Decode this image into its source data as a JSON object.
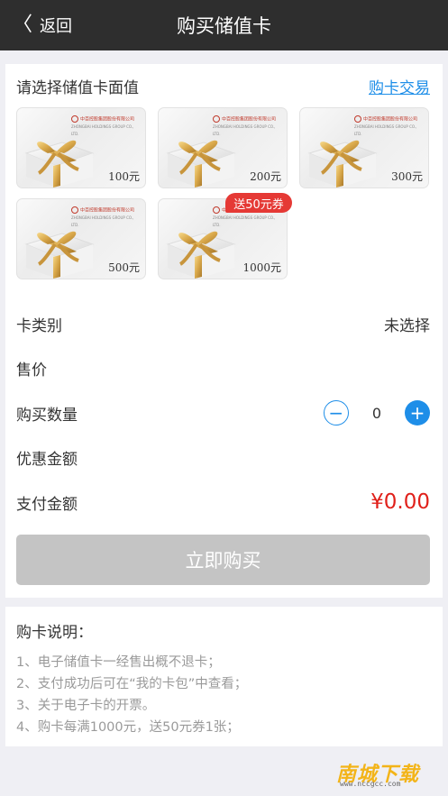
{
  "nav": {
    "back_icon": "〈",
    "back_label": "返回",
    "title": "购买储值卡"
  },
  "section": {
    "title": "请选择储值卡面值",
    "link": "购卡交易"
  },
  "card_logo": {
    "company": "中百控股集团股份有限公司",
    "company_en": "ZHONGBAI HOLDINGS GROUP CO., LTD."
  },
  "cards": [
    {
      "amount": "100元"
    },
    {
      "amount": "200元"
    },
    {
      "amount": "300元"
    },
    {
      "amount": "500元"
    },
    {
      "amount": "1000元"
    }
  ],
  "promo_tag": "送50元券",
  "rows": {
    "type_label": "卡类别",
    "type_value": "未选择",
    "price_label": "售价",
    "qty_label": "购买数量",
    "qty_value": "0",
    "minus": "−",
    "plus": "+",
    "discount_label": "优惠金额",
    "pay_label": "支付金额",
    "pay_value": "¥0.00"
  },
  "buy_button": "立即购买",
  "notes": {
    "title": "购卡说明：",
    "items": [
      "1、电子储值卡一经售出概不退卡；",
      "2、支付成功后可在“我的卡包”中查看；",
      "3、关于电子卡的开票。",
      "4、购卡每满1000元，送50元券1张；"
    ]
  },
  "watermark": {
    "text": "南城下载",
    "url": "www.nccgcc.com"
  },
  "colors": {
    "accent": "#1e8ee8",
    "price": "#e0201a",
    "promo": "#e53935",
    "navbar": "#2e2e2e"
  }
}
